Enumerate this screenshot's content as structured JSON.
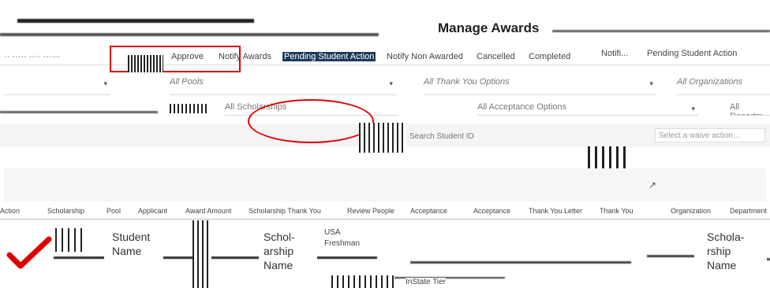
{
  "page": {
    "title": "Manage Awards"
  },
  "tabs": [
    {
      "label": "Approve"
    },
    {
      "label": "Notify Awards"
    },
    {
      "label": "Pending Student Action"
    },
    {
      "label": "Notify Non Awarded"
    },
    {
      "label": "Cancelled"
    },
    {
      "label": "Completed"
    },
    {
      "label": "Notifi..."
    },
    {
      "label": "Pending Student Action"
    }
  ],
  "filters": {
    "pools": "All Pools",
    "thank_you": "All Thank You Options",
    "organizations": "All Organizations",
    "scholarships": "All Scholarships",
    "acceptance": "All Acceptance Options",
    "departments": "All Departm"
  },
  "search": {
    "placeholder": "Search Student ID",
    "waive_action": "Select a waive action..."
  },
  "table": {
    "headers": [
      "Action",
      "Scholarship",
      "Pool",
      "Applicant",
      "Award Amount",
      "Scholarship Thank You",
      "Review People",
      "Acceptance",
      "Acceptance",
      "Thank You Letter",
      "Thank You",
      "Organization",
      "Department"
    ]
  },
  "row": {
    "cells": [
      "USA",
      "Freshman",
      "InState Tier"
    ]
  },
  "callouts": {
    "student_name": "Student Name",
    "scholarship_name_mid": "Schol-\narship\nName",
    "scholarship_name_right": "Schola-\nrship\nName"
  },
  "colors": {
    "highlight_red": "#e00000",
    "active_tab": "#1c3b5c"
  }
}
